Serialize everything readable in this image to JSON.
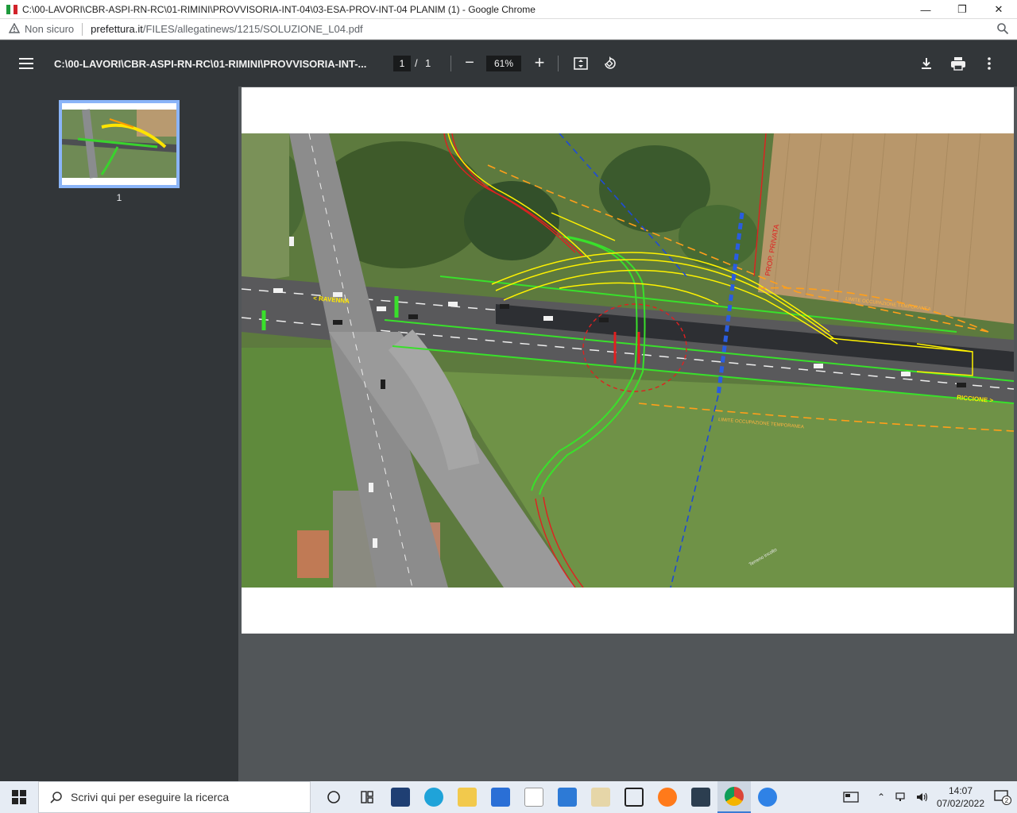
{
  "window": {
    "title": "C:\\00-LAVORI\\CBR-ASPI-RN-RC\\01-RIMINI\\PROVVISORIA-INT-04\\03-ESA-PROV-INT-04 PLANIM (1) - Google Chrome",
    "minimize": "—",
    "restore": "❐",
    "close": "✕"
  },
  "address": {
    "security_label": "Non sicuro",
    "host": "prefettura.it",
    "path": "/FILES/allegatinews/1215/SOLUZIONE_L04.pdf"
  },
  "pdf_toolbar": {
    "doc_title": "C:\\00-LAVORI\\CBR-ASPI-RN-RC\\01-RIMINI\\PROVVISORIA-INT-...",
    "current_page": "1",
    "page_separator": "/",
    "total_pages": "1",
    "zoom_out": "−",
    "zoom_level": "61%",
    "zoom_in": "+"
  },
  "sidebar": {
    "thumbnail_page_number": "1"
  },
  "map": {
    "label_ravenna": "< RAVENNA",
    "label_riccione": "RICCIONE >",
    "label_prop_privata": "PROP. PRIVATA",
    "label_limite_top": "LIMITE OCCUPAZIONE TEMPORANEA",
    "label_limite_bottom": "LIMITE OCCUPAZIONE TEMPORANEA",
    "label_terreno": "Terreno incolto"
  },
  "taskbar": {
    "search_placeholder": "Scrivi qui per eseguire la ricerca",
    "time": "14:07",
    "date": "07/02/2022",
    "notification_count": "2"
  },
  "colors": {
    "pdf_toolbar_bg": "#323639",
    "viewer_bg": "#525659",
    "thumb_highlight": "#8ab4f8"
  }
}
